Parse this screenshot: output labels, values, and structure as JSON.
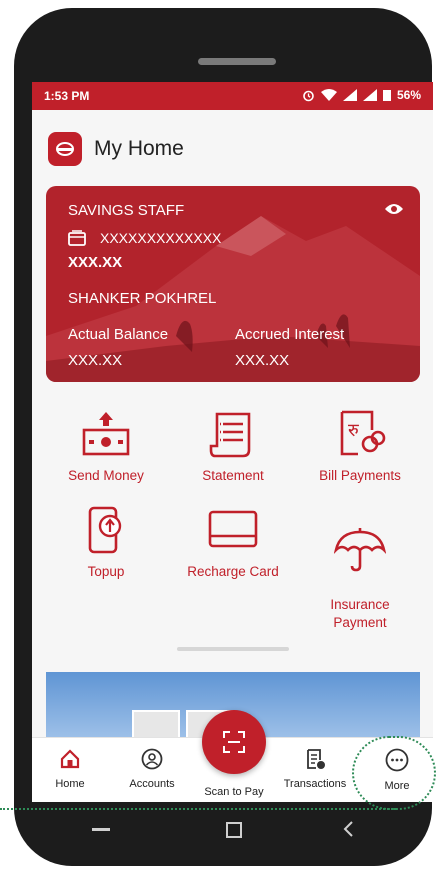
{
  "status_bar": {
    "time": "1:53 PM",
    "battery": "56%"
  },
  "header": {
    "title": "My Home"
  },
  "account_card": {
    "account_type": "SAVINGS STAFF",
    "account_number": "XXXXXXXXXXXXX",
    "balance": "XXX.XX",
    "holder_name": "SHANKER POKHREL",
    "actual_balance_label": "Actual Balance",
    "actual_balance_value": "XXX.XX",
    "accrued_interest_label": "Accrued Interest",
    "accrued_interest_value": "XXX.XX"
  },
  "quick_actions": [
    {
      "label": "Send Money",
      "icon": "send-money-icon"
    },
    {
      "label": "Statement",
      "icon": "statement-icon"
    },
    {
      "label": "Bill Payments",
      "icon": "bill-payments-icon"
    },
    {
      "label": "Topup",
      "icon": "topup-icon"
    },
    {
      "label": "Recharge Card",
      "icon": "recharge-card-icon"
    },
    {
      "label": "Insurance\nPayment",
      "icon": "umbrella-icon"
    }
  ],
  "bottom_nav": {
    "home": "Home",
    "accounts": "Accounts",
    "scan": "Scan to Pay",
    "transactions": "Transactions",
    "more": "More"
  },
  "colors": {
    "brand": "#c0202a",
    "highlight": "#2e8b57"
  }
}
